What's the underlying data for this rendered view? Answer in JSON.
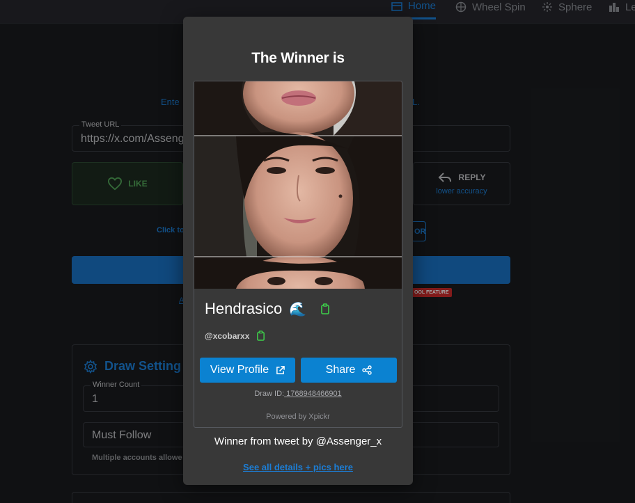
{
  "nav": {
    "items": [
      {
        "label": "Home",
        "icon": "home-icon",
        "active": true
      },
      {
        "label": "Wheel Spin",
        "icon": "wheel-icon",
        "active": false
      },
      {
        "label": "Sphere",
        "icon": "sphere-icon",
        "active": false
      },
      {
        "label": "Le",
        "icon": "leaderboard-icon",
        "active": false
      }
    ]
  },
  "background": {
    "hint_left": "Ente",
    "hint_right": "L.",
    "tweet_url_label": "Tweet URL",
    "tweet_url_value": "https://x.com/Asseng",
    "like_label": "LIKE",
    "reply_label": "REPLY",
    "reply_sub": "lower accuracy",
    "click_text": "Click to",
    "or_text": "OR",
    "tool_feature": "OOL FEATURE",
    "a_text": "A",
    "draw_settings_title": "Draw Setting",
    "winner_count_label": "Winner Count",
    "winner_count_value": "1",
    "must_follow_label": "Must Follow",
    "multiple_accounts_note": "Multiple accounts allowe"
  },
  "modal": {
    "title": "The Winner is",
    "winner_name": "Hendrasico",
    "winner_emoji": "🌊",
    "winner_handle": "@xcobarxx",
    "view_profile_label": "View Profile",
    "share_label": "Share",
    "draw_id_label": "Draw ID:",
    "draw_id_value": " 1768948466901",
    "powered_by": "Powered by Xpickr",
    "from_tweet": "Winner from tweet by @Assenger_x",
    "details_link": "See all details + pics here"
  },
  "colors": {
    "accent": "#1c7ed6",
    "button": "#0b82d1",
    "modal_bg": "#383838",
    "copy_icon": "#3ecf4a"
  }
}
